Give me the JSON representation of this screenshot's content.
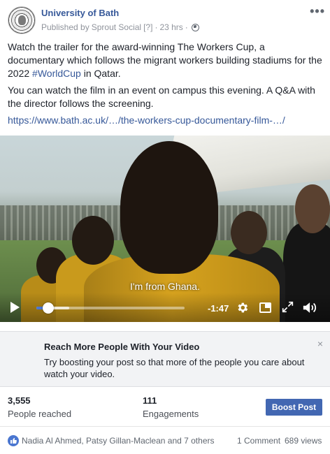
{
  "page": {
    "name": "University of Bath",
    "published_by_prefix": "Published by",
    "publisher": "Sprout Social",
    "help_marker": "[?]",
    "separator": "·",
    "timestamp": "23 hrs",
    "separator2": "·"
  },
  "post": {
    "paragraph1_a": "Watch the trailer for the award-winning The Workers Cup, a documentary which follows the migrant workers building stadiums for the 2022 ",
    "hashtag": "#WorldCup",
    "paragraph1_b": " in Qatar.",
    "paragraph2": "You can watch the film in an event on campus this evening. A Q&A with the director follows the screening.",
    "link": "https://www.bath.ac.uk/…/the-workers-cup-documentary-film-…/"
  },
  "video": {
    "subtitle": "I'm from Ghana.",
    "time_remaining": "-1:47",
    "progress_fraction": 0.08,
    "buffered_fraction": 0.22
  },
  "boost_card": {
    "title": "Reach More People With Your Video",
    "body": "Try boosting your post so that more of the people you care about watch your video.",
    "close": "×"
  },
  "stats": {
    "reached_value": "3,555",
    "reached_label": "People reached",
    "engagements_value": "111",
    "engagements_label": "Engagements",
    "boost_button": "Boost Post"
  },
  "footer": {
    "reactors": "Nadia Al Ahmed, Patsy Gillan-Maclean and 7 others",
    "comments": "1 Comment",
    "views": "689 views"
  },
  "colors": {
    "link_blue": "#365899",
    "button_blue": "#4267b2",
    "progress_blue": "#4b76d1"
  }
}
